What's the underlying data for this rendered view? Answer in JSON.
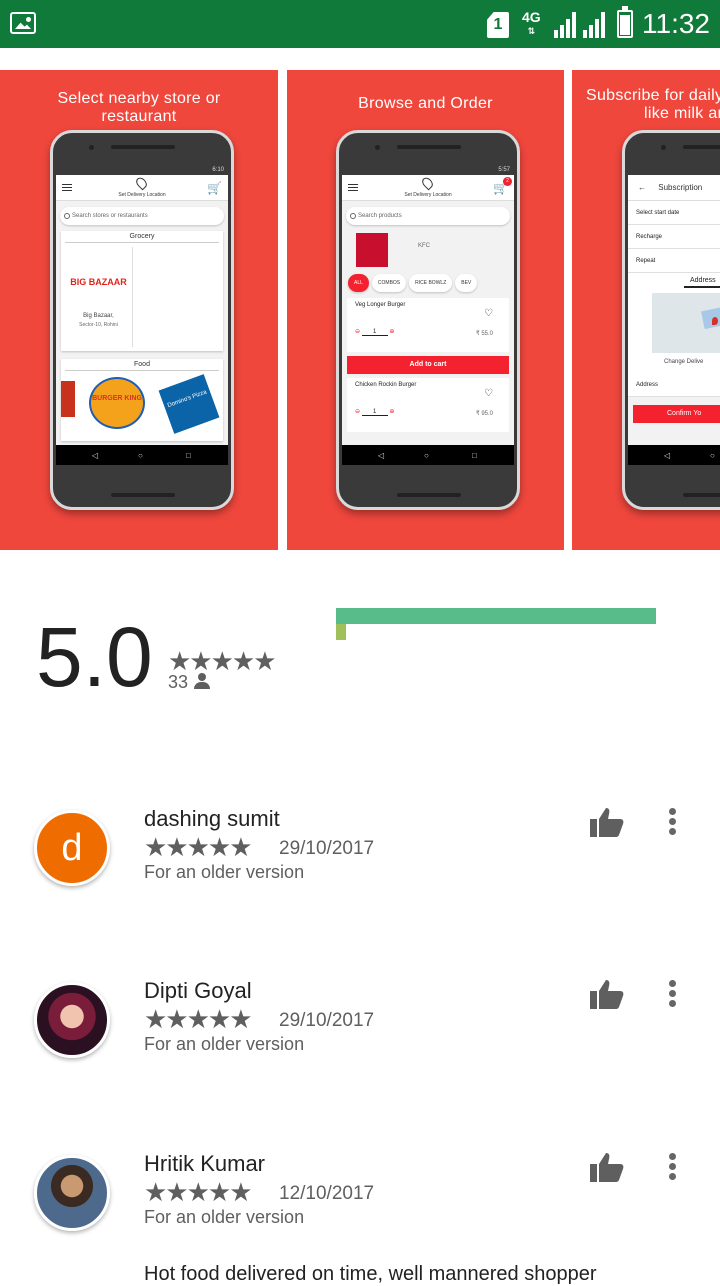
{
  "status_bar": {
    "sim_slot": "1",
    "network": "4G",
    "time": "11:32"
  },
  "gallery": [
    {
      "caption_line1": "Select nearby store or",
      "caption_line2": "restaurant",
      "phone_time": "6:10",
      "location_label": "Set Delivery Location",
      "search_placeholder": "Search stores or restaurants",
      "section1": "Grocery",
      "store_logo": "BIG BAZAAR",
      "store_name": "Big Bazaar,",
      "store_area": "Sector-10, Rohini",
      "section2": "Food",
      "food_logo1": "BURGER KING",
      "food_logo2": "Domino's Pizza"
    },
    {
      "caption_line1": "Browse and Order",
      "phone_time": "5:57",
      "cart_badge": "2",
      "location_label": "Set Delivery Location",
      "search_placeholder": "Search products",
      "brand": "KFC",
      "chips": [
        "ALL",
        "COMBOS",
        "RICE BOWLZ",
        "BEV"
      ],
      "items": [
        {
          "name": "Veg Longer Burger",
          "qty": "1",
          "price": "₹ 55.0"
        },
        {
          "name": "Chicken Rockin Burger",
          "qty": "1",
          "price": "₹ 95.0"
        }
      ],
      "add_to_cart": "Add to cart"
    },
    {
      "caption_line1": "Subscribe for daily",
      "caption_line2": "like milk an",
      "screen_title": "Subscription",
      "rows": [
        "Select start date",
        "Recharge",
        "Repeat"
      ],
      "tab": "Address",
      "map_link": "Change Delive",
      "address_label": "Address",
      "confirm": "Confirm Yo"
    }
  ],
  "rating": {
    "score": "5.0",
    "stars": "★★★★★",
    "count": "33",
    "five_star_fraction": 1.0
  },
  "reviews": [
    {
      "name": "dashing sumit",
      "initial": "d",
      "stars": "★★★★★",
      "date": "29/10/2017",
      "version": "For an older version",
      "body": ""
    },
    {
      "name": "Dipti Goyal",
      "initial": "",
      "stars": "★★★★★",
      "date": "29/10/2017",
      "version": "For an older version",
      "body": ""
    },
    {
      "name": "Hritik Kumar",
      "initial": "",
      "stars": "★★★★★",
      "date": "12/10/2017",
      "version": "For an older version",
      "body": "Hot food delivered on time, well mannered shopper"
    }
  ],
  "colors": {
    "status_bar": "#0f7a3a",
    "promo_red": "#f0473d",
    "bar_green": "#57bb8a",
    "avatar_orange": "#ef6c00"
  }
}
